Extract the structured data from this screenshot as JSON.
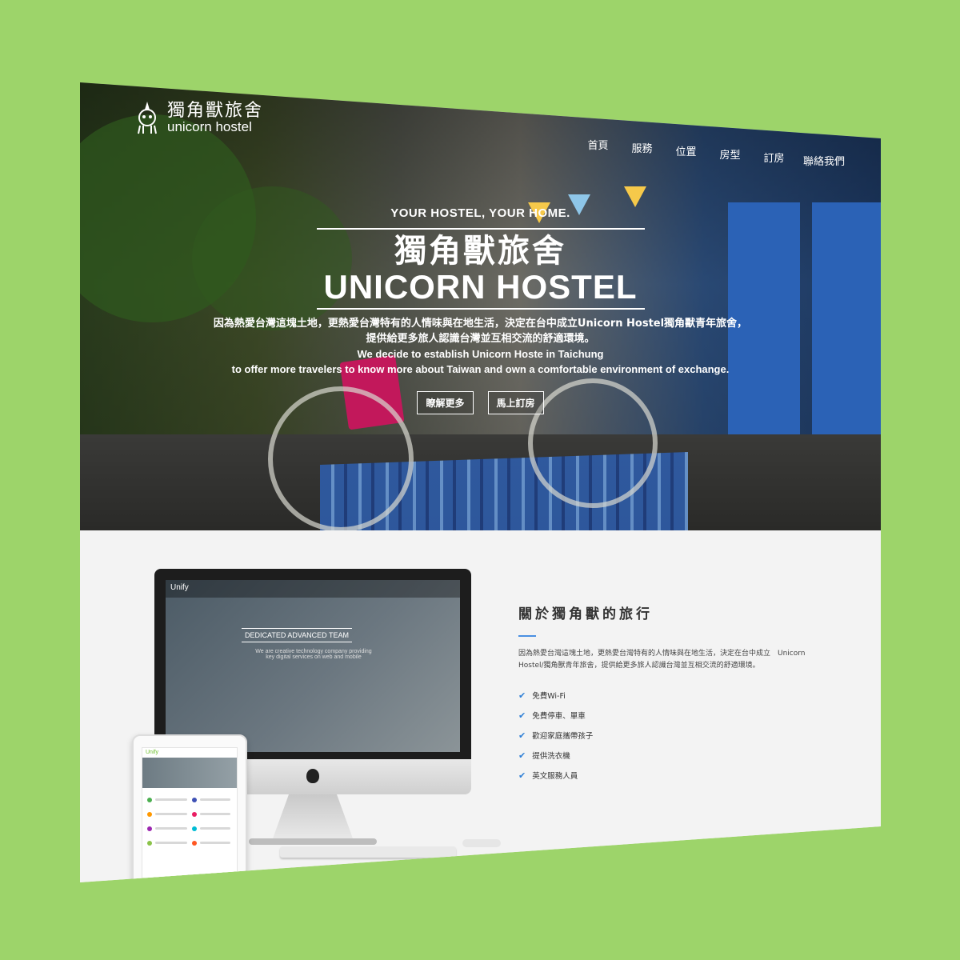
{
  "colors": {
    "background": "#9dd46a",
    "accent": "#2e7fd6"
  },
  "header": {
    "logo_zh": "獨角獸旅舍",
    "logo_en": "unicorn hostel",
    "nav": [
      "首頁",
      "服務",
      "位置",
      "房型",
      "訂房",
      "聯絡我們"
    ]
  },
  "hero": {
    "tagline": "YOUR HOSTEL, YOUR HOME.",
    "title_zh": "獨角獸旅舍",
    "title_en": "UNICORN HOSTEL",
    "desc_zh_1": "因為熱愛台灣這塊土地，更熱愛台灣特有的人情味與在地生活，決定在台中成立Unicorn Hostel獨角獸青年旅舍，",
    "desc_zh_2": "提供給更多旅人認識台灣並互相交流的舒適環境。",
    "desc_en_1": "We decide to establish Unicorn Hoste in Taichung",
    "desc_en_2": "to offer more travelers to know more about Taiwan and own a comfortable environment of exchange.",
    "btn_more": "瞭解更多",
    "btn_book": "馬上訂房"
  },
  "about": {
    "title": "關於獨角獸的旅行",
    "body": "因為熱愛台灣這塊土地，更熱愛台灣特有的人情味與在地生活，決定在台中成立　Unicorn Hostel/獨角獸青年旅舍，提供給更多旅人認識台灣並互相交流的舒適環境。",
    "features": [
      "免費Wi-Fi",
      "免費停車、單車",
      "歡迎家庭攜帶孩子",
      "提供洗衣機",
      "英文服務人員"
    ]
  },
  "device_mockup": {
    "brand": "Unify",
    "headline": "DEDICATED ADVANCED TEAM",
    "sub": "We are creative technology company providing key digital services on web and mobile",
    "tablet_brand": "Unify"
  }
}
